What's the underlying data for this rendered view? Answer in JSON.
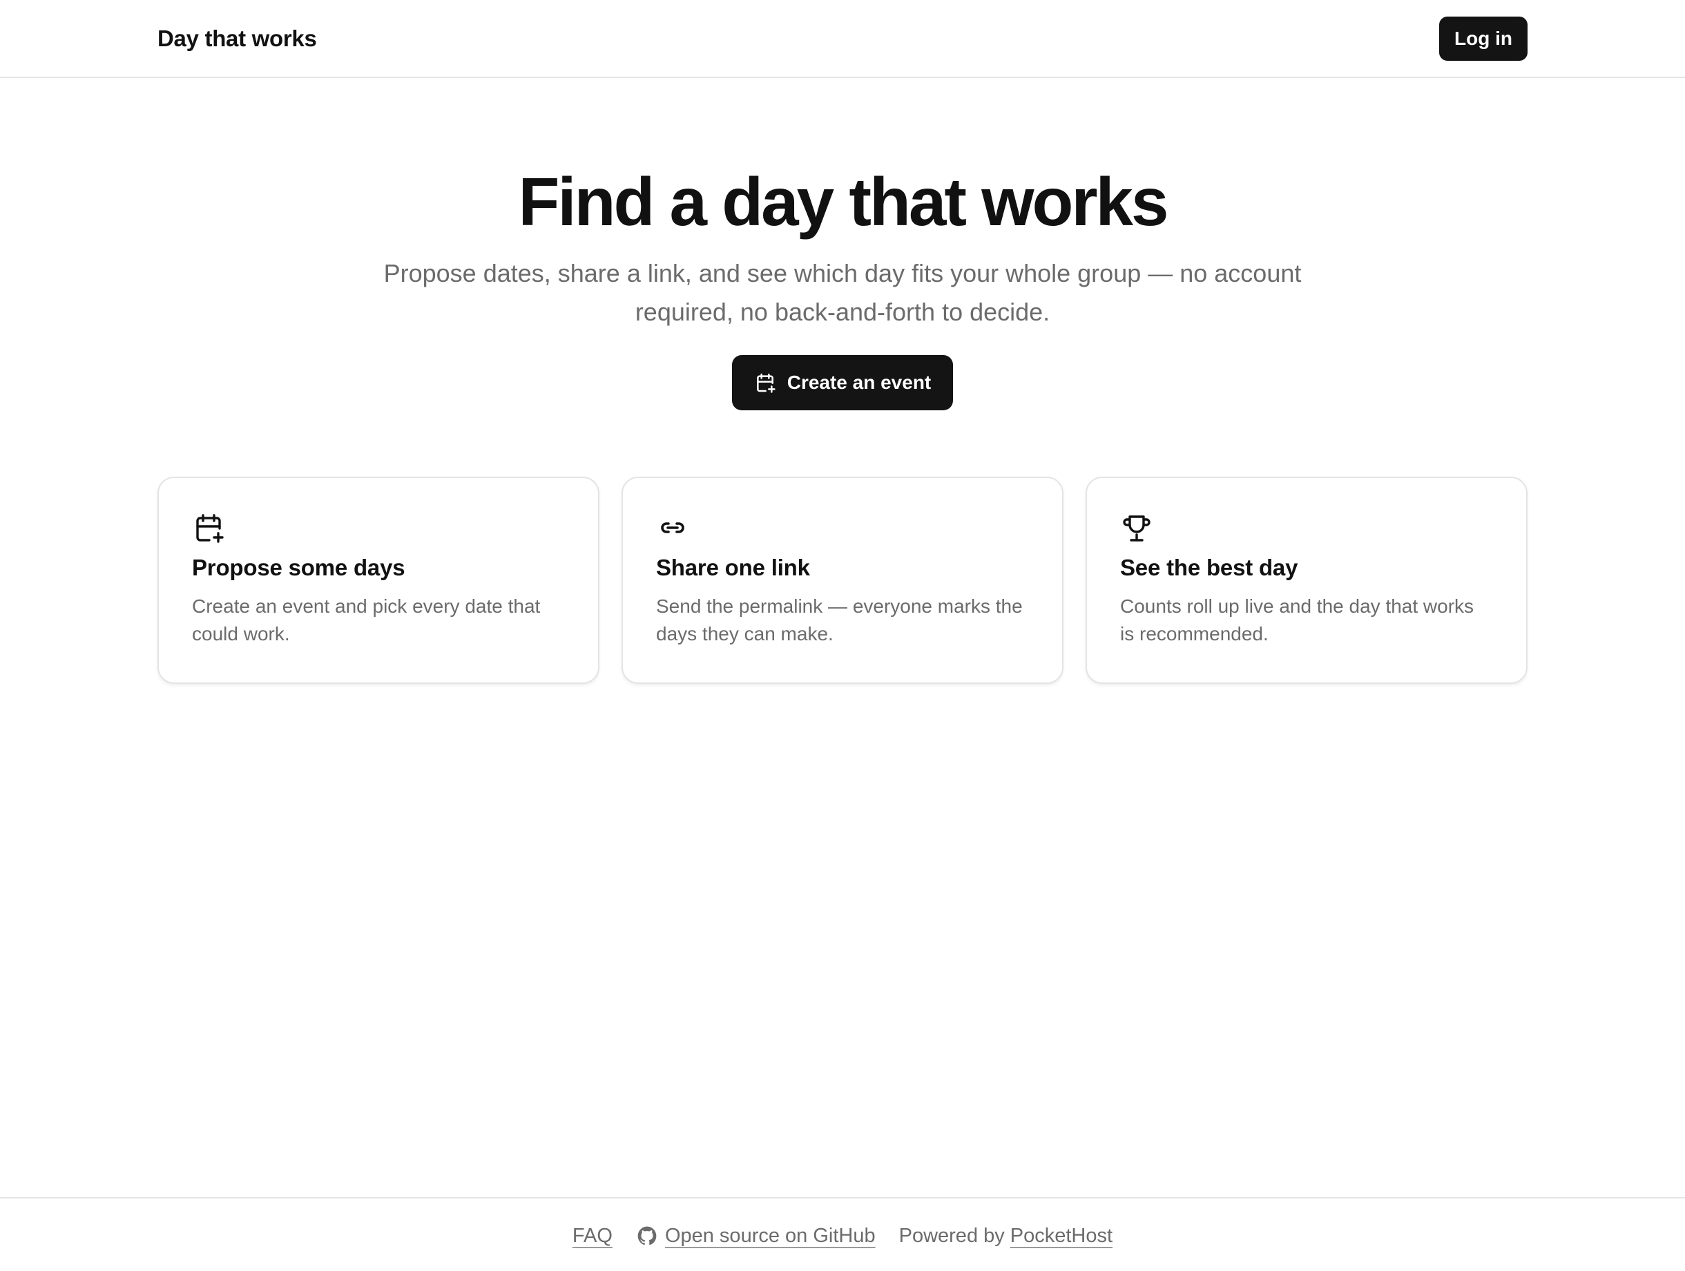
{
  "header": {
    "brand": "Day that works",
    "login_label": "Log in"
  },
  "hero": {
    "title": "Find a day that works",
    "subtitle": "Propose dates, share a link, and see which day fits your whole group — no account required, no back-and-forth to decide.",
    "cta_label": "Create an event",
    "cta_icon": "calendar-plus-icon"
  },
  "features": [
    {
      "icon": "calendar-plus-icon",
      "title": "Propose some days",
      "body": "Create an event and pick every date that could work."
    },
    {
      "icon": "link-icon",
      "title": "Share one link",
      "body": "Send the permalink — everyone marks the days they can make."
    },
    {
      "icon": "trophy-icon",
      "title": "See the best day",
      "body": "Counts roll up live and the day that works is recommended."
    }
  ],
  "footer": {
    "faq_label": "FAQ",
    "github_label": "Open source on GitHub",
    "github_icon": "github-icon",
    "powered_prefix": "Powered by",
    "powered_link": "PocketHost"
  },
  "colors": {
    "primary_button": "#141414",
    "muted_text": "#6b6b6b",
    "border": "#e4e4e4"
  }
}
